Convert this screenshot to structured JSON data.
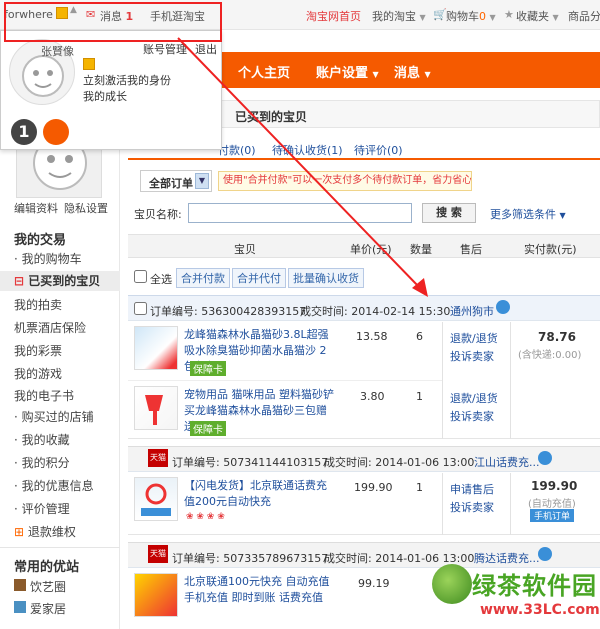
{
  "topbar": {
    "user": "forwhere",
    "messages_label": "消息",
    "messages_count": "1",
    "mobile_label": "手机逛淘宝",
    "taobao_home": "淘宝网首页",
    "my_taobao": "我的淘宝",
    "cart_label": "购物车",
    "cart_count": "0",
    "favorites": "收藏夹",
    "categories": "商品分类"
  },
  "popup": {
    "name": "张賢像",
    "account_mgmt": "账号管理",
    "logout": "退出",
    "activate": "立刻激活我的身份",
    "growth": "我的成长"
  },
  "nav": {
    "home": "个人主页",
    "settings": "账户设置",
    "messages": "消息"
  },
  "left": {
    "edit_profile": "编辑资料",
    "privacy": "隐私设置",
    "my_trades_heading": "我的交易",
    "items": [
      "我的购物车",
      "已买到的宝贝",
      "我的拍卖",
      "机票酒店保险",
      "我的彩票",
      "我的游戏",
      "我的电子书",
      "购买过的店铺",
      "我的收藏",
      "我的积分",
      "我的优惠信息",
      "评价管理",
      "退款维权"
    ],
    "common_heading": "常用的优站",
    "common_items": [
      "饮艺圈",
      "爱家居"
    ]
  },
  "content": {
    "breadcrumb": "已买到的宝贝",
    "tabs": [
      "付款(0)",
      "待确认收货(1)",
      "待评价(0)"
    ],
    "all_orders": "全部订单",
    "notice": "使用\"合并付款\"可以一次支付多个待付款订单，省力省心",
    "search_label": "宝贝名称:",
    "search_button": "搜 索",
    "more_filters": "更多筛选条件",
    "col_item": "宝贝",
    "col_price": "单价(元)",
    "col_qty": "数量",
    "col_after": "售后",
    "col_paid": "实付款(元)",
    "select_all": "全选",
    "merge_pay": "合并付款",
    "merge_proxy": "合并代付",
    "batch_confirm": "批量确认收货",
    "order_no_label": "订单编号:",
    "deal_time_label": "成交时间:",
    "refund": "退款/退货",
    "complain": "投诉卖家",
    "guarantee": "保障卡",
    "apply_aftersale": "申请售后",
    "tmall": "天猫"
  },
  "orders": [
    {
      "order_no": "536300428393157",
      "time": "2014-02-14 15:30",
      "shop": "通州狗市",
      "total": "78.76",
      "shipping": "(含快递:0.00)",
      "products": [
        {
          "title": "龙峰猫森林水晶猫砂3.8L超强吸水除臭猫砂抑菌水晶猫沙 2包包邮",
          "price": "13.58",
          "qty": "6"
        },
        {
          "title": "宠物用品 猫咪用品 塑料猫砂铲 买龙峰猫森林水晶猫砂三包赠送",
          "price": "3.80",
          "qty": "1"
        }
      ]
    },
    {
      "order_no": "507341144103157",
      "time": "2014-01-06 13:00",
      "shop": "江山话费充...",
      "total": "199.90",
      "recharge": "(自动充值)",
      "phone_order": "手机订单",
      "products": [
        {
          "title": "【闪电发货】北京联通话费充值200元自动快充",
          "price": "199.90",
          "qty": "1"
        }
      ]
    },
    {
      "order_no": "507335789673157",
      "time": "2014-01-06 13:00",
      "shop": "腾达话费充...",
      "products": [
        {
          "title": "北京联通100元快充 自动充值 手机充值 即时到账 话费充值",
          "price": "99.19",
          "qty": ""
        }
      ]
    }
  ],
  "watermark": {
    "brand": "绿茶软件园",
    "url": "www.33LC.com"
  }
}
